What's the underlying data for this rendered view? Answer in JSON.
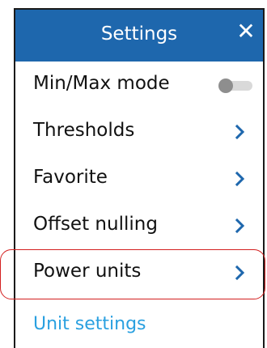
{
  "header": {
    "title": "Settings",
    "close_icon": "close-icon",
    "background": "#1e67ad"
  },
  "menu": {
    "items": [
      {
        "label": "Min/Max mode",
        "control": "toggle",
        "enabled": false
      },
      {
        "label": "Thresholds",
        "control": "chevron"
      },
      {
        "label": "Favorite",
        "control": "chevron"
      },
      {
        "label": "Offset nulling",
        "control": "chevron"
      },
      {
        "label": "Power units",
        "control": "chevron",
        "highlighted": true
      }
    ]
  },
  "section": {
    "label": "Unit settings",
    "color": "#2aa0e0"
  },
  "highlight_color": "#d32020",
  "chevron_color": "#1e67ad"
}
